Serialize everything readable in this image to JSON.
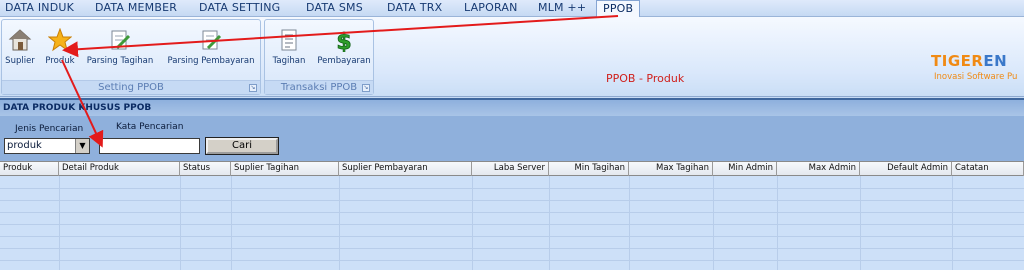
{
  "menu": [
    "DATA INDUK",
    "DATA MEMBER",
    "DATA SETTING",
    "DATA SMS",
    "DATA TRX",
    "LAPORAN",
    "MLM ++",
    "PPOB"
  ],
  "ribbon": {
    "setting_group": {
      "title": "Setting PPOB",
      "buttons": [
        "Suplier",
        "Produk",
        "Parsing Tagihan",
        "Parsing Pembayaran"
      ]
    },
    "transaksi_group": {
      "title": "Transaksi PPOB",
      "buttons": [
        "Tagihan",
        "Pembayaran"
      ]
    }
  },
  "page_title": "PPOB - Produk",
  "logo": {
    "part1": "TIGER",
    "part2": "EN",
    "tagline": "Inovasi Software Pu"
  },
  "panel_title": "DATA PRODUK KHUSUS PPOB",
  "search": {
    "jenis_label": "Jenis Pencarian",
    "kata_label": "Kata Pencarian",
    "jenis_value": "produk",
    "kata_value": "",
    "button": "Cari"
  },
  "columns": [
    "Produk",
    "Detail Produk",
    "Status",
    "Suplier Tagihan",
    "Suplier Pembayaran",
    "Laba Server",
    "Min Tagihan",
    "Max Tagihan",
    "Min Admin",
    "Max Admin",
    "Default Admin",
    "Catatan"
  ],
  "colors": {
    "arrow": "#e31b1b",
    "title_red": "#d0201c",
    "logo_orange": "#f08a14"
  }
}
